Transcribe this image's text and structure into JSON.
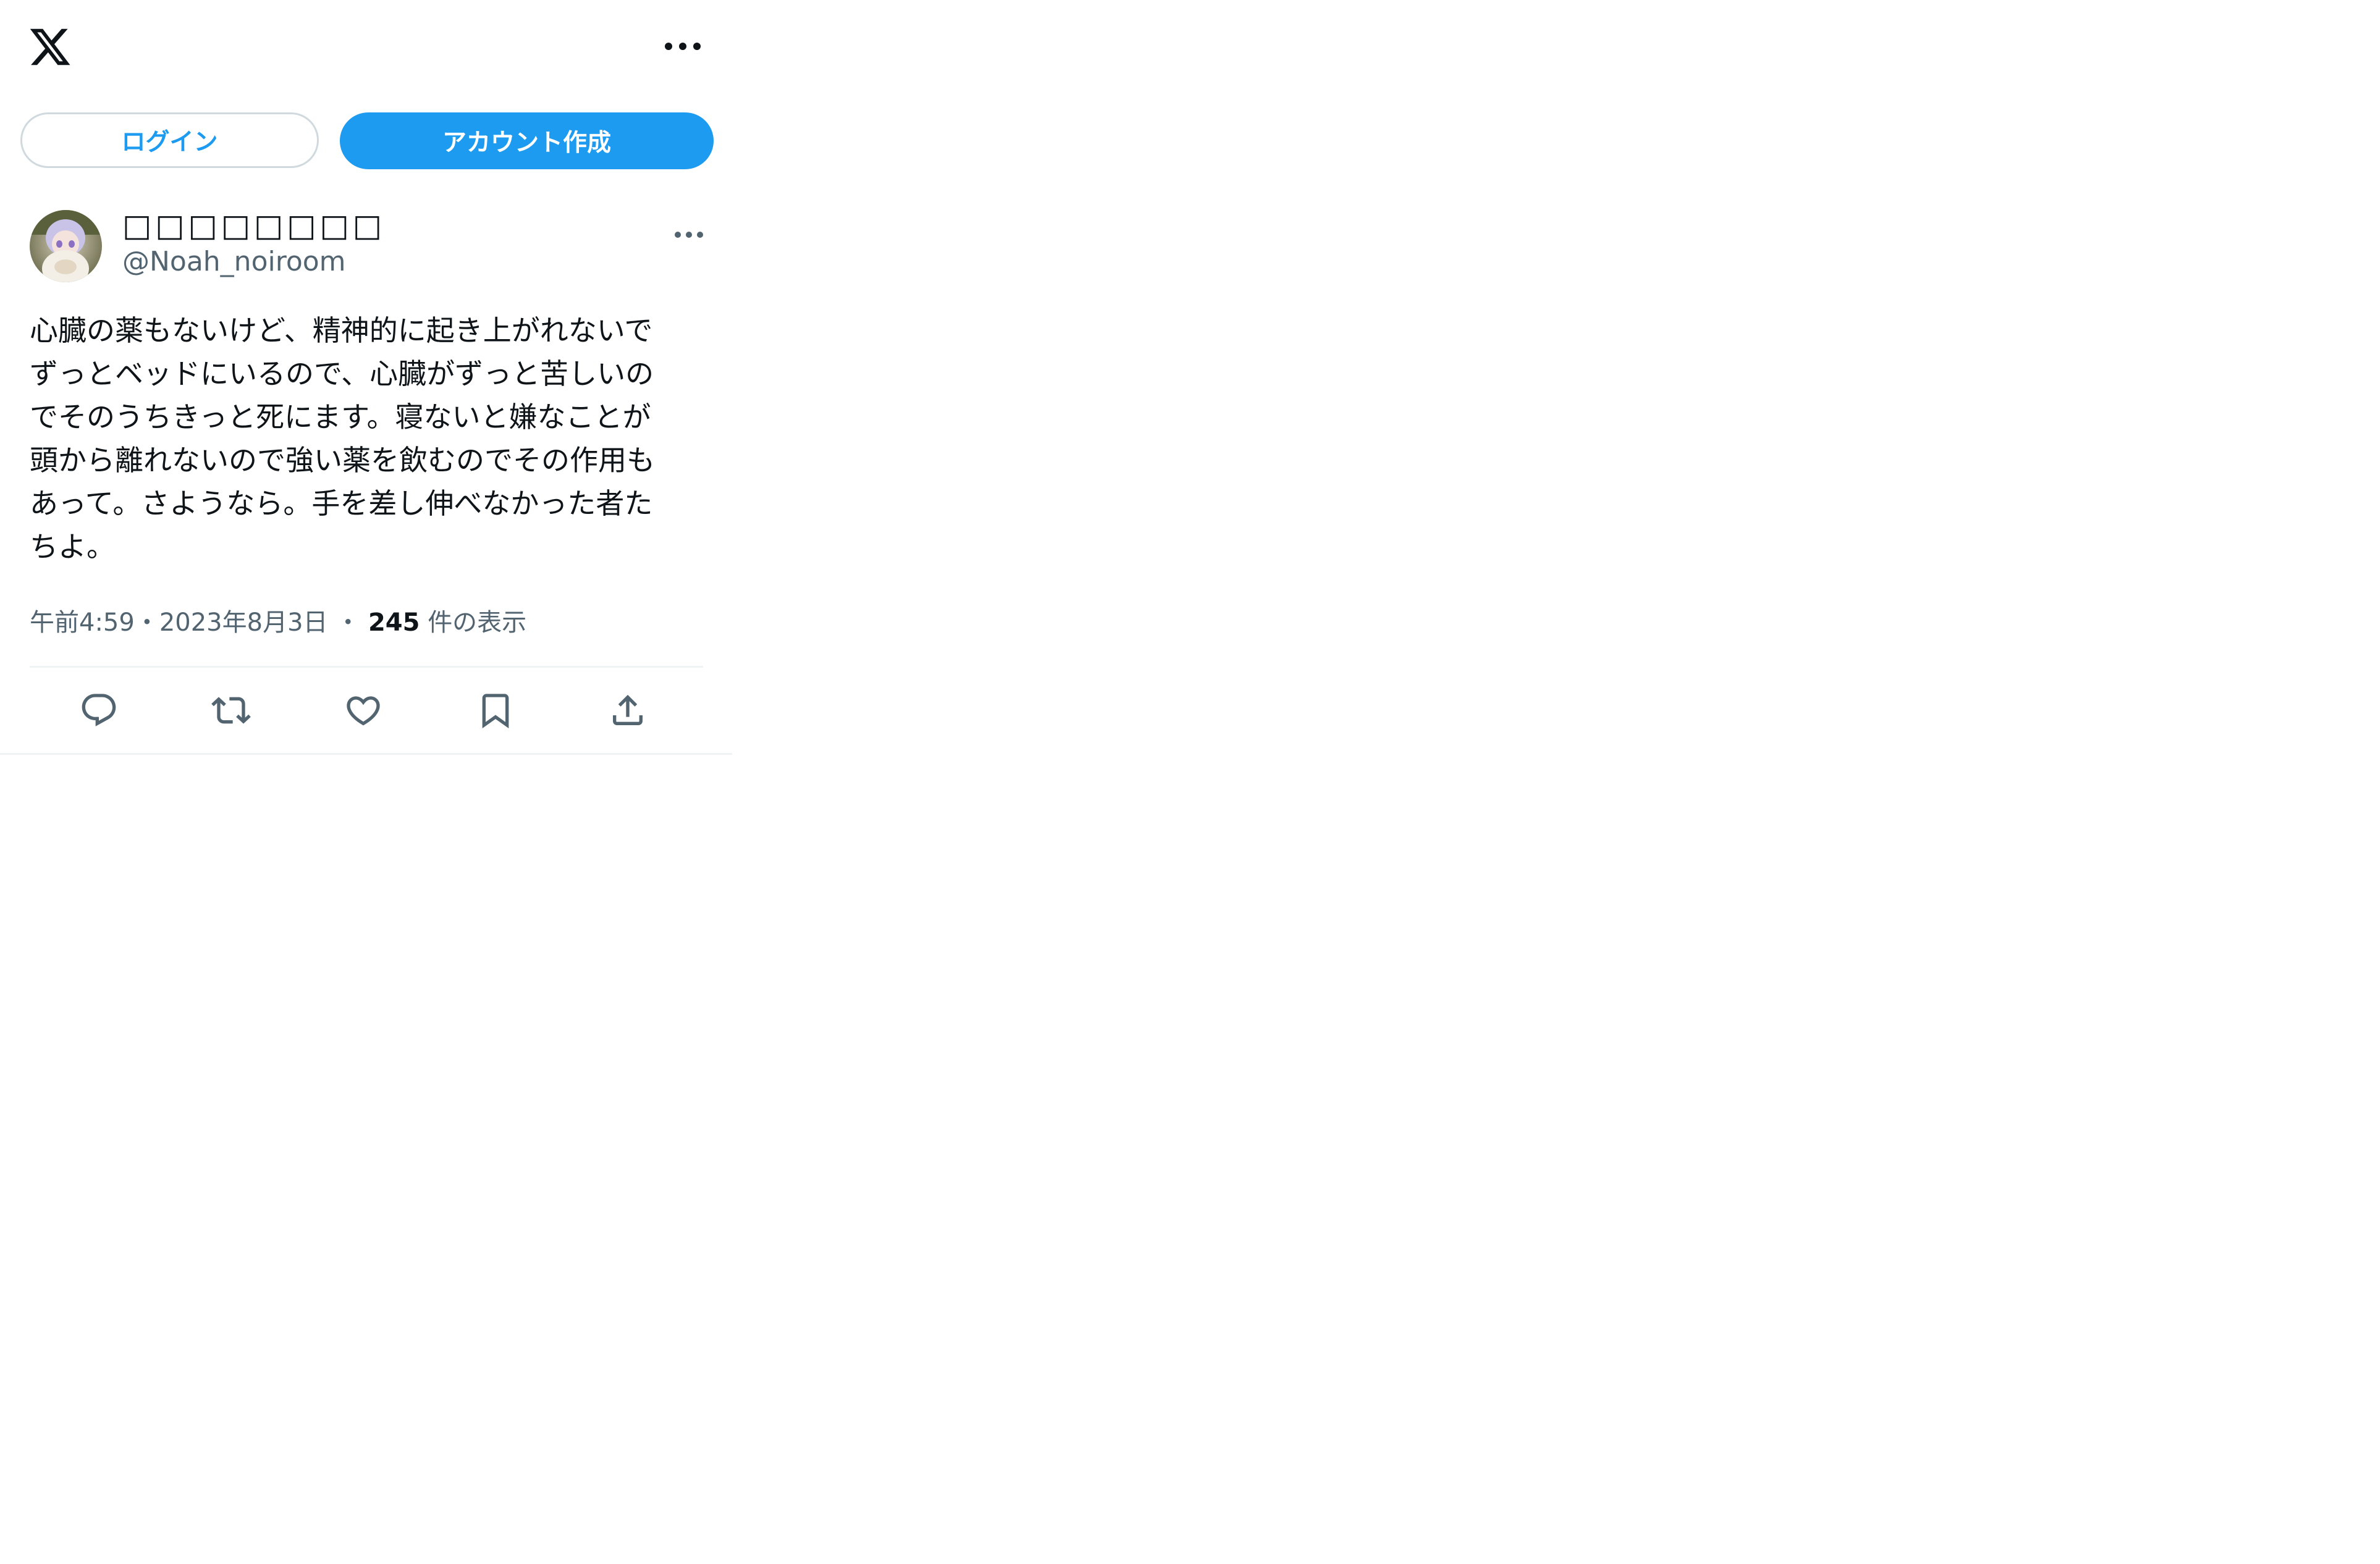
{
  "header": {
    "logo_icon": "x-logo-icon",
    "more_icon": "more-horizontal-icon"
  },
  "auth": {
    "login_label": "ログイン",
    "signup_label": "アカウント作成",
    "accent_color": "#1d9bf0"
  },
  "tweet": {
    "display_name": "□□□□□□□□",
    "handle": "@Noah_noiroom",
    "avatar_icon": "profile-avatar",
    "more_icon": "more-horizontal-icon",
    "text": "心臓の薬もないけど、精神的に起き上がれないで\nずっとベッドにいるので、心臓がずっと苦しいの\nでそのうちきっと死にます。寝ないと嫌なことが\n頭から離れないので強い薬を飲むのでその作用も\nあって。さようなら。手を差し伸べなかった者た\nちよ。",
    "time": "午前4:59",
    "separator": "・",
    "date": "2023年8月3日",
    "views_count": "245",
    "views_label": "件の表示"
  },
  "actions": [
    {
      "name": "reply-icon"
    },
    {
      "name": "retweet-icon"
    },
    {
      "name": "like-icon"
    },
    {
      "name": "bookmark-icon"
    },
    {
      "name": "share-icon"
    }
  ]
}
